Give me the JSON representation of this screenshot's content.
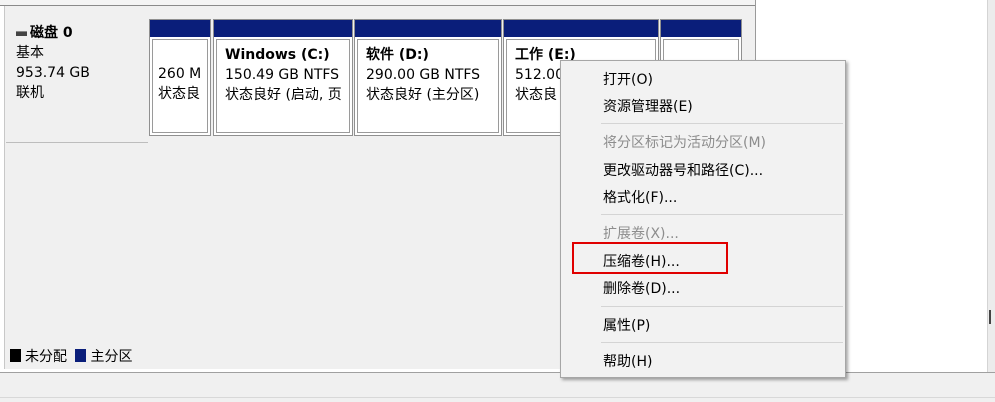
{
  "disk": {
    "title": "磁盘 0",
    "type": "基本",
    "size": "953.74 GB",
    "status": "联机"
  },
  "volumes": [
    {
      "name": "",
      "size": "260 M",
      "status": "状态良"
    },
    {
      "name": "Windows  (C:)",
      "size": "150.49 GB NTFS",
      "status": "状态良好 (启动, 页"
    },
    {
      "name": "软件  (D:)",
      "size": "290.00 GB NTFS",
      "status": "状态良好 (主分区)"
    },
    {
      "name": "工作  (E:)",
      "size": "512.00",
      "status": "状态良"
    },
    {
      "name": "",
      "size": "",
      "status": ""
    }
  ],
  "legend": {
    "unallocated": "未分配",
    "primary": "主分区"
  },
  "colors": {
    "primary_partition": "#0a1e7a",
    "unallocated": "#000000",
    "highlight": "#e00000"
  },
  "context_menu": {
    "open": "打开(O)",
    "explorer": "资源管理器(E)",
    "mark_active": "将分区标记为活动分区(M)",
    "change_letter": "更改驱动器号和路径(C)...",
    "format": "格式化(F)...",
    "extend": "扩展卷(X)...",
    "shrink": "压缩卷(H)...",
    "delete": "删除卷(D)...",
    "properties": "属性(P)",
    "help": "帮助(H)"
  }
}
